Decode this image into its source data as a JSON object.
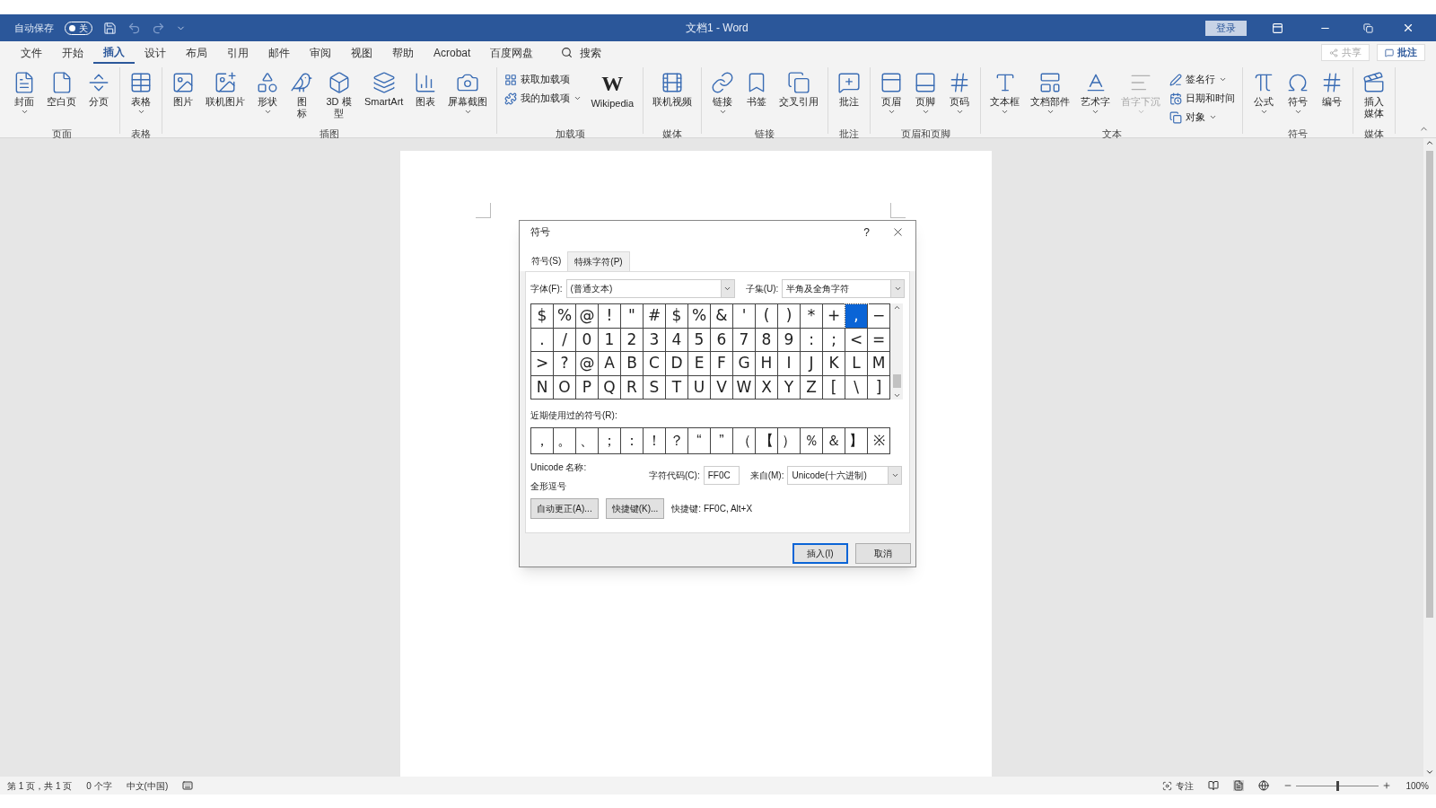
{
  "title_bar": {
    "autosave_label": "自动保存",
    "autosave_toggle": {
      "label": "关",
      "on": false
    },
    "title": "文档1 - Word",
    "sign_in": "登录"
  },
  "tabs": [
    {
      "label": "文件",
      "selected": false
    },
    {
      "label": "开始",
      "selected": false
    },
    {
      "label": "插入",
      "selected": true
    },
    {
      "label": "设计",
      "selected": false
    },
    {
      "label": "布局",
      "selected": false
    },
    {
      "label": "引用",
      "selected": false
    },
    {
      "label": "邮件",
      "selected": false
    },
    {
      "label": "审阅",
      "selected": false
    },
    {
      "label": "视图",
      "selected": false
    },
    {
      "label": "帮助",
      "selected": false
    },
    {
      "label": "Acrobat",
      "selected": false
    },
    {
      "label": "百度网盘",
      "selected": false
    }
  ],
  "search": {
    "label": "搜索"
  },
  "share": {
    "label": "共享",
    "disabled": true
  },
  "comments": {
    "label": "批注"
  },
  "ribbon": [
    {
      "name": "页面",
      "items": [
        {
          "kind": "large",
          "label": "封面",
          "dropdown": true,
          "disabled": false
        },
        {
          "kind": "large",
          "label": "空白页",
          "dropdown": false,
          "disabled": false
        },
        {
          "kind": "large",
          "label": "分页",
          "dropdown": false,
          "disabled": false
        }
      ]
    },
    {
      "name": "表格",
      "items": [
        {
          "kind": "large",
          "label": "表格",
          "dropdown": true,
          "disabled": false
        }
      ]
    },
    {
      "name": "插图",
      "items": [
        {
          "kind": "large",
          "label": "图片",
          "dropdown": false,
          "disabled": false
        },
        {
          "kind": "large",
          "label": "联机图片",
          "dropdown": false,
          "disabled": false
        },
        {
          "kind": "large",
          "label": "形状",
          "dropdown": true,
          "disabled": false
        },
        {
          "kind": "large",
          "label": "图标",
          "wrap": true,
          "dropdown": false,
          "disabled": false
        },
        {
          "kind": "large",
          "label": "3D 模型",
          "wrap": true,
          "dropdown": false,
          "disabled": false
        },
        {
          "kind": "large",
          "label": "SmartArt",
          "dropdown": false,
          "disabled": false
        },
        {
          "kind": "large",
          "label": "图表",
          "dropdown": false,
          "disabled": false
        },
        {
          "kind": "large",
          "label": "屏幕截图",
          "dropdown": true,
          "disabled": false
        }
      ]
    },
    {
      "name": "加载项",
      "items": [
        {
          "kind": "small",
          "label": "获取加载项",
          "dropdown": false,
          "disabled": false
        },
        {
          "kind": "small",
          "label": "我的加载项",
          "dropdown": true,
          "disabled": false
        },
        {
          "kind": "logo",
          "glyph": "W",
          "label": "Wikipedia",
          "dropdown": false,
          "disabled": false
        }
      ]
    },
    {
      "name": "媒体",
      "items": [
        {
          "kind": "large",
          "label": "联机视频",
          "dropdown": false,
          "disabled": false
        }
      ]
    },
    {
      "name": "链接",
      "items": [
        {
          "kind": "large",
          "label": "链接",
          "dropdown": true,
          "disabled": false
        },
        {
          "kind": "large",
          "label": "书签",
          "dropdown": false,
          "disabled": false
        },
        {
          "kind": "large",
          "label": "交叉引用",
          "dropdown": false,
          "disabled": false
        }
      ]
    },
    {
      "name": "批注",
      "items": [
        {
          "kind": "large",
          "label": "批注",
          "dropdown": false,
          "disabled": false
        }
      ]
    },
    {
      "name": "页眉和页脚",
      "items": [
        {
          "kind": "large",
          "label": "页眉",
          "dropdown": true,
          "disabled": false
        },
        {
          "kind": "large",
          "label": "页脚",
          "dropdown": true,
          "disabled": false
        },
        {
          "kind": "large",
          "label": "页码",
          "dropdown": true,
          "disabled": false
        }
      ]
    },
    {
      "name": "文本",
      "items": [
        {
          "kind": "large",
          "label": "文本框",
          "dropdown": true,
          "disabled": false
        },
        {
          "kind": "large",
          "label": "文档部件",
          "dropdown": true,
          "disabled": false
        },
        {
          "kind": "large",
          "label": "艺术字",
          "dropdown": true,
          "disabled": false
        },
        {
          "kind": "large",
          "label": "首字下沉",
          "dropdown": true,
          "disabled": true
        },
        {
          "kind": "small",
          "label": "签名行",
          "dropdown": true,
          "disabled": false
        },
        {
          "kind": "small",
          "label": "日期和时间",
          "dropdown": false,
          "disabled": false
        },
        {
          "kind": "small",
          "label": "对象",
          "dropdown": true,
          "disabled": false
        }
      ]
    },
    {
      "name": "符号",
      "items": [
        {
          "kind": "large",
          "label": "公式",
          "dropdown": true,
          "disabled": false
        },
        {
          "kind": "large",
          "label": "符号",
          "dropdown": true,
          "disabled": false
        },
        {
          "kind": "large",
          "label": "编号",
          "dropdown": false,
          "disabled": false
        }
      ]
    },
    {
      "name": "媒体",
      "items": [
        {
          "kind": "large",
          "label": "插入媒体",
          "wrap": true,
          "dropdown": false,
          "disabled": false
        }
      ]
    }
  ],
  "dialog": {
    "title": "符号",
    "help": "?",
    "tabs": [
      {
        "label": "符号(S)",
        "selected": true
      },
      {
        "label": "特殊字符(P)",
        "selected": false
      }
    ],
    "font": {
      "label": "字体(F):",
      "value": "(普通文本)"
    },
    "subset": {
      "label": "子集(U):",
      "value": "半角及全角字符"
    },
    "grid": [
      [
        {
          "char": "$",
          "selected": false
        },
        {
          "char": "%",
          "selected": false
        },
        {
          "char": "@",
          "selected": false
        },
        {
          "char": "!",
          "selected": false
        },
        {
          "char": "\"",
          "selected": false
        },
        {
          "char": "#",
          "selected": false
        },
        {
          "char": "$",
          "selected": false
        },
        {
          "char": "%",
          "selected": false
        },
        {
          "char": "&",
          "selected": false
        },
        {
          "char": "'",
          "selected": false
        },
        {
          "char": "(",
          "selected": false
        },
        {
          "char": ")",
          "selected": false
        },
        {
          "char": "*",
          "selected": false
        },
        {
          "char": "+",
          "selected": false
        },
        {
          "char": ",",
          "selected": true
        },
        {
          "char": "−",
          "selected": false
        }
      ],
      [
        {
          "char": ".",
          "selected": false
        },
        {
          "char": "/",
          "selected": false
        },
        {
          "char": "0",
          "selected": false
        },
        {
          "char": "1",
          "selected": false
        },
        {
          "char": "2",
          "selected": false
        },
        {
          "char": "3",
          "selected": false
        },
        {
          "char": "4",
          "selected": false
        },
        {
          "char": "5",
          "selected": false
        },
        {
          "char": "6",
          "selected": false
        },
        {
          "char": "7",
          "selected": false
        },
        {
          "char": "8",
          "selected": false
        },
        {
          "char": "9",
          "selected": false
        },
        {
          "char": ":",
          "selected": false
        },
        {
          "char": ";",
          "selected": false
        },
        {
          "char": "<",
          "selected": false
        },
        {
          "char": "=",
          "selected": false
        }
      ],
      [
        {
          "char": ">",
          "selected": false
        },
        {
          "char": "?",
          "selected": false
        },
        {
          "char": "@",
          "selected": false
        },
        {
          "char": "A",
          "selected": false
        },
        {
          "char": "B",
          "selected": false
        },
        {
          "char": "C",
          "selected": false
        },
        {
          "char": "D",
          "selected": false
        },
        {
          "char": "E",
          "selected": false
        },
        {
          "char": "F",
          "selected": false
        },
        {
          "char": "G",
          "selected": false
        },
        {
          "char": "H",
          "selected": false
        },
        {
          "char": "I",
          "selected": false
        },
        {
          "char": "J",
          "selected": false
        },
        {
          "char": "K",
          "selected": false
        },
        {
          "char": "L",
          "selected": false
        },
        {
          "char": "M",
          "selected": false
        }
      ],
      [
        {
          "char": "N",
          "selected": false
        },
        {
          "char": "O",
          "selected": false
        },
        {
          "char": "P",
          "selected": false
        },
        {
          "char": "Q",
          "selected": false
        },
        {
          "char": "R",
          "selected": false
        },
        {
          "char": "S",
          "selected": false
        },
        {
          "char": "T",
          "selected": false
        },
        {
          "char": "U",
          "selected": false
        },
        {
          "char": "V",
          "selected": false
        },
        {
          "char": "W",
          "selected": false
        },
        {
          "char": "X",
          "selected": false
        },
        {
          "char": "Y",
          "selected": false
        },
        {
          "char": "Z",
          "selected": false
        },
        {
          "char": "[",
          "selected": false
        },
        {
          "char": "\\",
          "selected": false
        },
        {
          "char": "]",
          "selected": false
        }
      ]
    ],
    "recent_label": "近期使用过的符号(R):",
    "recent": [
      "，",
      "。",
      "、",
      "；",
      "：",
      "！",
      "？",
      "“",
      "”",
      "（",
      "【",
      "）",
      "％",
      "＆",
      "】",
      "※"
    ],
    "unicode_name_label": "Unicode 名称:",
    "unicode_name": "全形逗号",
    "char_code": {
      "label": "字符代码(C):",
      "value": "FF0C"
    },
    "from": {
      "label": "来自(M):",
      "value": "Unicode(十六进制)"
    },
    "autocorrect": "自动更正(A)...",
    "shortcut_button": "快捷键(K)...",
    "shortcut_text": "快捷键: FF0C, Alt+X",
    "insert": "插入(I)",
    "cancel": "取消"
  },
  "status_bar": {
    "page": "第 1 页，共 1 页",
    "words": "0 个字",
    "language": "中文(中国)",
    "focus": "专注",
    "zoom": "100%",
    "zoom_slider": {
      "level": 0.5
    }
  }
}
